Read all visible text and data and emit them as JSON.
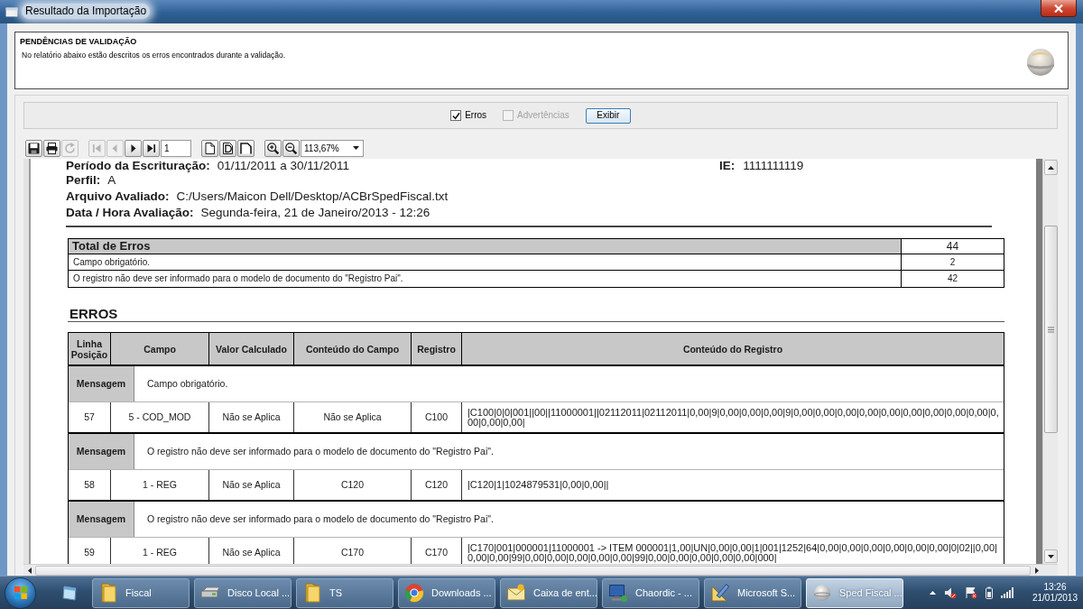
{
  "window": {
    "title": "Resultado da Importação"
  },
  "header": {
    "title": "PENDÊNCIAS DE VALIDAÇÃO",
    "description": "No relatório abaixo estão descritos os erros encontrados durante a validação."
  },
  "filters": [
    {
      "label": "Erros",
      "checked": true,
      "disabled": false
    },
    {
      "label": "Advertências",
      "checked": false,
      "disabled": true
    }
  ],
  "show_button": "Exibir",
  "toolbar": {
    "groups": [
      {
        "buttons": [
          {
            "kind": "save",
            "disabled": false
          },
          {
            "kind": "print",
            "disabled": false
          },
          {
            "kind": "refresh",
            "disabled": true
          }
        ]
      },
      {
        "buttons": [
          {
            "kind": "first",
            "disabled": true
          },
          {
            "kind": "previous",
            "disabled": true
          },
          {
            "kind": "next",
            "disabled": false
          },
          {
            "kind": "last",
            "disabled": false
          }
        ],
        "page": "1"
      },
      {
        "buttons": [
          {
            "kind": "page",
            "disabled": false
          },
          {
            "kind": "pagewidth",
            "disabled": false
          },
          {
            "kind": "corner",
            "disabled": false
          }
        ]
      },
      {
        "buttons": [
          {
            "kind": "zoomin",
            "disabled": false
          },
          {
            "kind": "zoomout",
            "disabled": false
          }
        ],
        "zoom": "113,67%"
      }
    ]
  },
  "report": {
    "info": [
      {
        "label": "Período da Escrituração:",
        "value": "01/11/2011 a 30/11/2011"
      },
      {
        "label": "Perfil:",
        "value": "A"
      },
      {
        "label": "Arquivo Avaliado:",
        "value": "C:/Users/Maicon Dell/Desktop/ACBrSpedFiscal.txt"
      },
      {
        "label": "Data / Hora Avaliação:",
        "value": "Segunda-feira, 21 de Janeiro/2013 - 12:26"
      }
    ],
    "ie": {
      "label": "IE:",
      "value": "1111111119"
    },
    "totals": {
      "title": "Total de Erros",
      "count": "44",
      "rows": [
        {
          "message": "Campo obrigatório.",
          "count": "2"
        },
        {
          "message": "O registro não deve ser informado para o modelo de documento do \"Registro Pai\".",
          "count": "42"
        }
      ]
    },
    "errors": {
      "heading": "ERROS",
      "columns": [
        "Linha Posição",
        "Campo",
        "Valor Calculado",
        "Conteúdo do Campo",
        "Registro",
        "Conteúdo do Registro"
      ],
      "groups": [
        {
          "label": "Mensagem",
          "message": "Campo obrigatório.",
          "rows": [
            {
              "line": "57",
              "field": "5 - COD_MOD",
              "calculated": "Não se Aplica",
              "field_content": "Não se Aplica",
              "record": "C100",
              "record_content": "|C100|0|0|001||00||11000001||02112011|02112011|0,00|9|0,00|0,00|0,00|9|0,00|0,00|0,00|0,00|0,00|0,00|0,00|0,00|0,00|0,00|0,00|0,00|"
            }
          ]
        },
        {
          "label": "Mensagem",
          "message": "O registro não deve ser informado para o modelo de documento do \"Registro Pai\".",
          "rows": [
            {
              "line": "58",
              "field": "1 - REG",
              "calculated": "Não se Aplica",
              "field_content": "C120",
              "record": "C120",
              "record_content": "|C120|1|1024879531|0,00|0,00||"
            }
          ]
        },
        {
          "label": "Mensagem",
          "message": "O registro não deve ser informado para o modelo de documento do \"Registro Pai\".",
          "rows": [
            {
              "line": "59",
              "field": "1 - REG",
              "calculated": "Não se Aplica",
              "field_content": "C170",
              "record": "C170",
              "record_content": "|C170|001|000001|11000001 -> ITEM 000001|1,00|UN|0,00|0,00|1|001|1252|64|0,00|0,00|0,00|0,00|0,00|0,00|0|02||0,00|0,00|0,00|99|0,00|0,00|0,00|0,00|0,00|99|0,00|0,00|0,00|0,00|0,00|000|"
            }
          ]
        }
      ]
    }
  },
  "taskbar": {
    "items": [
      {
        "kind": "folder",
        "label": "Fiscal",
        "selected": false
      },
      {
        "kind": "drive",
        "label": "Disco Local ...",
        "selected": false
      },
      {
        "kind": "folder",
        "label": "TS",
        "selected": false
      },
      {
        "kind": "browser",
        "label": "Downloads ...",
        "selected": false
      },
      {
        "kind": "mail",
        "label": "Caixa de ent...",
        "selected": false
      },
      {
        "kind": "computer",
        "label": "Chaordic - ...",
        "selected": false
      },
      {
        "kind": "tools",
        "label": "Microsoft S...",
        "selected": false
      },
      {
        "kind": "sphere",
        "label": "Sped Fiscal ...",
        "selected": true
      }
    ],
    "time": "13:26",
    "date": "21/01/2013"
  }
}
